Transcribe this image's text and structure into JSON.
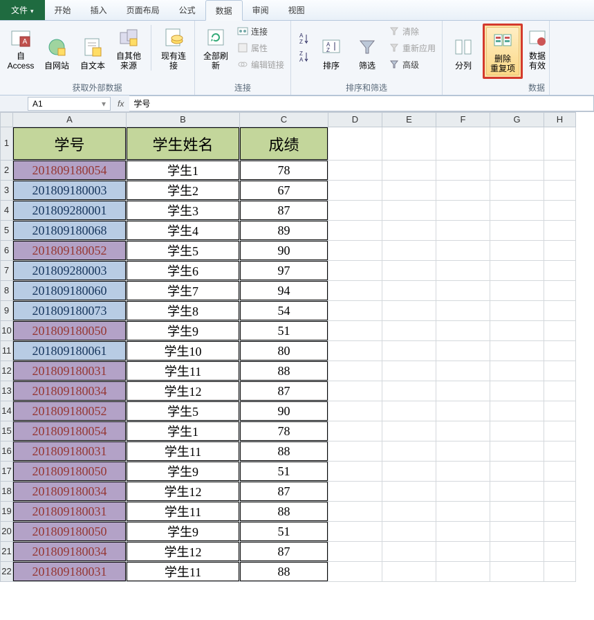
{
  "menu": {
    "file": "文件",
    "home": "开始",
    "insert": "插入",
    "layout": "页面布局",
    "formulas": "公式",
    "data": "数据",
    "review": "审阅",
    "view": "视图"
  },
  "ribbon": {
    "ext": {
      "access": "自 Access",
      "web": "自网站",
      "text": "自文本",
      "other": "自其他来源",
      "existing": "现有连接",
      "label": "获取外部数据"
    },
    "conn": {
      "refresh": "全部刷新",
      "connections": "连接",
      "properties": "属性",
      "editlinks": "编辑链接",
      "label": "连接"
    },
    "sort": {
      "az": "A|Z",
      "za": "Z|A",
      "sort": "排序",
      "filter": "筛选",
      "clear": "清除",
      "reapply": "重新应用",
      "advanced": "高级",
      "label": "排序和筛选"
    },
    "tools": {
      "columns": "分列",
      "dup": "删除\n重复项",
      "valid": "数据\n有效",
      "label": "数据"
    }
  },
  "formula": {
    "cellref": "A1",
    "fx": "fx",
    "value": "学号"
  },
  "cols": [
    "A",
    "B",
    "C",
    "D",
    "E",
    "F",
    "G",
    "H"
  ],
  "headers": {
    "A": "学号",
    "B": "学生姓名",
    "C": "成绩"
  },
  "rows": [
    {
      "n": 1,
      "hdr": true
    },
    {
      "n": 2,
      "id": "201809180054",
      "name": "学生1",
      "score": "78",
      "red": true
    },
    {
      "n": 3,
      "id": "201809180003",
      "name": "学生2",
      "score": "67",
      "red": false
    },
    {
      "n": 4,
      "id": "201809280001",
      "name": "学生3",
      "score": "87",
      "red": false
    },
    {
      "n": 5,
      "id": "201809180068",
      "name": "学生4",
      "score": "89",
      "red": false
    },
    {
      "n": 6,
      "id": "201809180052",
      "name": "学生5",
      "score": "90",
      "red": true
    },
    {
      "n": 7,
      "id": "201809280003",
      "name": "学生6",
      "score": "97",
      "red": false
    },
    {
      "n": 8,
      "id": "201809180060",
      "name": "学生7",
      "score": "94",
      "red": false
    },
    {
      "n": 9,
      "id": "201809180073",
      "name": "学生8",
      "score": "54",
      "red": false
    },
    {
      "n": 10,
      "id": "201809180050",
      "name": "学生9",
      "score": "51",
      "red": true
    },
    {
      "n": 11,
      "id": "201809180061",
      "name": "学生10",
      "score": "80",
      "red": false
    },
    {
      "n": 12,
      "id": "201809180031",
      "name": "学生11",
      "score": "88",
      "red": true
    },
    {
      "n": 13,
      "id": "201809180034",
      "name": "学生12",
      "score": "87",
      "red": true
    },
    {
      "n": 14,
      "id": "201809180052",
      "name": "学生5",
      "score": "90",
      "red": true
    },
    {
      "n": 15,
      "id": "201809180054",
      "name": "学生1",
      "score": "78",
      "red": true
    },
    {
      "n": 16,
      "id": "201809180031",
      "name": "学生11",
      "score": "88",
      "red": true
    },
    {
      "n": 17,
      "id": "201809180050",
      "name": "学生9",
      "score": "51",
      "red": true
    },
    {
      "n": 18,
      "id": "201809180034",
      "name": "学生12",
      "score": "87",
      "red": true
    },
    {
      "n": 19,
      "id": "201809180031",
      "name": "学生11",
      "score": "88",
      "red": true
    },
    {
      "n": 20,
      "id": "201809180050",
      "name": "学生9",
      "score": "51",
      "red": true
    },
    {
      "n": 21,
      "id": "201809180034",
      "name": "学生12",
      "score": "87",
      "red": true
    },
    {
      "n": 22,
      "id": "201809180031",
      "name": "学生11",
      "score": "88",
      "red": true
    }
  ]
}
